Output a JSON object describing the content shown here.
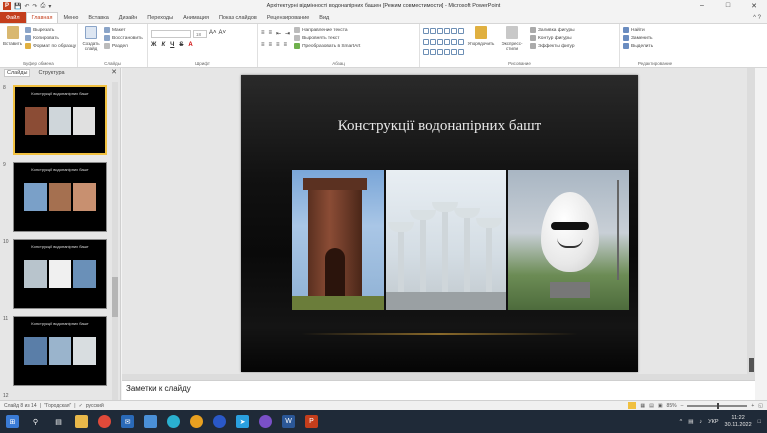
{
  "window": {
    "title": "Архітектурні відмінності водонапірних башен [Режим совместимости] - Microsoft PowerPoint",
    "minimize": "–",
    "maximize": "□",
    "close": "✕"
  },
  "tabs": {
    "file": "Файл",
    "items": [
      "Главная",
      "Меню",
      "Вставка",
      "Дизайн",
      "Переходы",
      "Анимация",
      "Показ слайдов",
      "Рецензирование",
      "Вид"
    ],
    "help": "^ ?"
  },
  "ribbon": {
    "clipboard": {
      "label": "Буфер обмена",
      "paste": "Вставить",
      "cut": "Вырезать",
      "copy": "Копировать",
      "format_painter": "Формат по образцу"
    },
    "slides": {
      "label": "Слайды",
      "new_slide": "Создать слайд",
      "layout": "Макет",
      "reset": "Восстановить",
      "section": "Раздел"
    },
    "font": {
      "label": "Шрифт",
      "font_name": "",
      "font_size": "18",
      "bold": "Ж",
      "italic": "К",
      "underline": "Ч",
      "strike": "S"
    },
    "paragraph": {
      "label": "Абзац",
      "text_direction": "Направление текста",
      "align_text": "Выровнять текст",
      "smartart": "Преобразовать в SmartArt"
    },
    "drawing": {
      "label": "Рисование",
      "arrange": "Упорядочить",
      "quick_styles": "Экспресс-стили",
      "shape_fill": "Заливка фигуры",
      "shape_outline": "Контур фигуры",
      "shape_effects": "Эффекты фигур"
    },
    "editing": {
      "label": "Редактирование",
      "find": "Найти",
      "replace": "Заменить",
      "select": "Выделить"
    }
  },
  "slides_pane": {
    "tabs": [
      "Слайды",
      "Структура"
    ],
    "close": "✕",
    "thumbs": [
      {
        "num": "8",
        "title": "Конструкції водонапірних башт",
        "selected": true
      },
      {
        "num": "9",
        "title": "Конструкції водонапірних башт",
        "selected": false
      },
      {
        "num": "10",
        "title": "Конструкції водонапірних башт",
        "selected": false
      },
      {
        "num": "11",
        "title": "Конструкції водонапірних башт",
        "selected": false
      },
      {
        "num": "12",
        "title": "",
        "selected": false
      }
    ]
  },
  "slide": {
    "title": "Конструкції водонапірних башт"
  },
  "notes": {
    "placeholder": "Заметки к слайду"
  },
  "statusbar": {
    "slide_info": "Слайд 8 из 14",
    "theme": "\"Городская\"",
    "language": "русский",
    "zoom": "85%"
  },
  "taskbar": {
    "tray_lang": "УКР",
    "time": "11:22",
    "date": "30.11.2022"
  },
  "colors": {
    "accent": "#c43e1c",
    "selection": "#f0c040",
    "taskbar": "#1f2a38"
  }
}
